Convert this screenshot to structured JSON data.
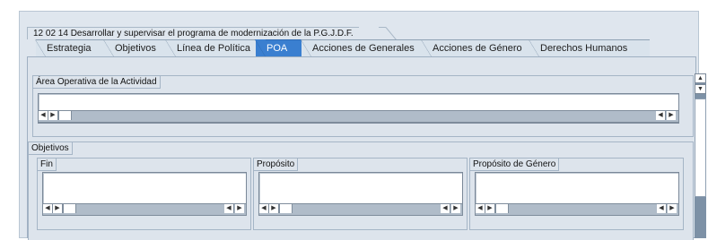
{
  "header": {
    "title": "12 02 14  Desarrollar y supervisar el programa de modernización de la P.G.J.D.F."
  },
  "tabs": [
    {
      "label": "Estrategia",
      "active": false
    },
    {
      "label": "Objetivos",
      "active": false
    },
    {
      "label": "Línea de Política",
      "active": false
    },
    {
      "label": "POA",
      "active": true
    },
    {
      "label": "Acciones de Generales",
      "active": false
    },
    {
      "label": "Acciones de Género",
      "active": false
    },
    {
      "label": "Derechos Humanos",
      "active": false
    }
  ],
  "area_operativa": {
    "title": "Área Operativa de la Actividad",
    "value": ""
  },
  "objetivos": {
    "title": "Objetivos",
    "fin": {
      "title": "Fin",
      "value": ""
    },
    "proposito": {
      "title": "Propósito",
      "value": ""
    },
    "proposito_genero": {
      "title": "Propósito de Género",
      "value": ""
    }
  },
  "icons": {
    "left_arrow": "arrow-left-icon",
    "right_arrow": "arrow-right-icon",
    "up_arrow": "arrow-up-icon",
    "down_arrow": "arrow-down-icon"
  }
}
